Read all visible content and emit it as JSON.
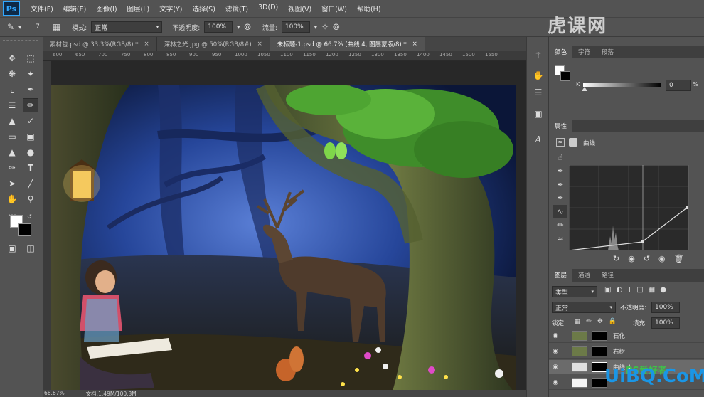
{
  "app": {
    "logo": "Ps"
  },
  "menu": [
    "文件(F)",
    "编辑(E)",
    "图像(I)",
    "图层(L)",
    "文字(Y)",
    "选择(S)",
    "滤镜(T)",
    "3D(D)",
    "视图(V)",
    "窗口(W)",
    "帮助(H)"
  ],
  "options": {
    "brush_size": "7",
    "mode_label": "模式:",
    "mode_value": "正常",
    "opacity_label": "不透明度:",
    "opacity_value": "100%",
    "flow_label": "流量:",
    "flow_value": "100%"
  },
  "tabs": [
    {
      "label": "素材包.psd @ 33.3%(RGB/8) *",
      "active": false
    },
    {
      "label": "深林之光.jpg @ 50%(RGB/8#)",
      "active": false
    },
    {
      "label": "未标题-1.psd @ 66.7% (曲线 4, 图层蒙版/8) *",
      "active": true
    }
  ],
  "ruler": [
    "600",
    "650",
    "700",
    "750",
    "800",
    "850",
    "900",
    "950",
    "1000",
    "1050",
    "1100",
    "1150",
    "1200",
    "1250",
    "1300",
    "1350",
    "1400",
    "1450",
    "1500",
    "1550"
  ],
  "status": {
    "zoom": "66.67%",
    "doc": "文档:1.49M/100.3M"
  },
  "color_panel": {
    "tabs": [
      "颜色",
      "字符",
      "段落"
    ],
    "channel": "K",
    "value": "0",
    "unit": "%"
  },
  "properties_panel": {
    "title": "属性",
    "curve_label": "曲线"
  },
  "layers_panel": {
    "tabs": [
      "图层",
      "通道",
      "路径"
    ],
    "filter": "类型",
    "blend_mode": "正常",
    "opacity_label": "不透明度:",
    "opacity_value": "100%",
    "lock_label": "锁定:",
    "fill_label": "填充:",
    "fill_value": "100%",
    "layers": [
      {
        "name": "石化",
        "selected": false
      },
      {
        "name": "右树",
        "selected": false
      },
      {
        "name": "曲线 4",
        "selected": true
      },
      {
        "name": "",
        "selected": false
      }
    ]
  },
  "watermarks": {
    "top": "虎课网",
    "bottom": "UiBQ.CoM",
    "bottom_small": "PS爱好者"
  },
  "colors": {
    "ui_bg": "#535353",
    "panel_dark": "#3f3f3f",
    "accent_blue": "#31a8ff"
  }
}
